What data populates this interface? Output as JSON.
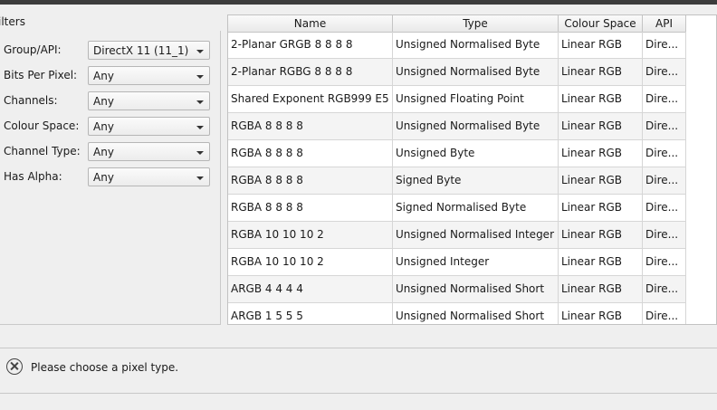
{
  "filters": {
    "title": "ilters",
    "rows": [
      {
        "label": "Group/API:",
        "value": "DirectX 11 (11_1)"
      },
      {
        "label": "Bits Per Pixel:",
        "value": "Any"
      },
      {
        "label": "Channels:",
        "value": "Any"
      },
      {
        "label": "Colour Space:",
        "value": "Any"
      },
      {
        "label": "Channel Type:",
        "value": "Any"
      },
      {
        "label": "Has Alpha:",
        "value": "Any"
      }
    ]
  },
  "table": {
    "columns": [
      "Name",
      "Type",
      "Colour Space",
      "API"
    ],
    "rows": [
      [
        "2-Planar GRGB 8 8 8 8",
        "Unsigned Normalised Byte",
        "Linear RGB",
        "Dire..."
      ],
      [
        "2-Planar RGBG 8 8 8 8",
        "Unsigned Normalised Byte",
        "Linear RGB",
        "Dire..."
      ],
      [
        "Shared Exponent RGB999 E5",
        "Unsigned Floating Point",
        "Linear RGB",
        "Dire..."
      ],
      [
        "RGBA 8 8 8 8",
        "Unsigned Normalised Byte",
        "Linear RGB",
        "Dire..."
      ],
      [
        "RGBA 8 8 8 8",
        "Unsigned Byte",
        "Linear RGB",
        "Dire..."
      ],
      [
        "RGBA 8 8 8 8",
        "Signed Byte",
        "Linear RGB",
        "Dire..."
      ],
      [
        "RGBA 8 8 8 8",
        "Signed Normalised Byte",
        "Linear RGB",
        "Dire..."
      ],
      [
        "RGBA 10 10 10 2",
        "Unsigned Normalised Integer",
        "Linear RGB",
        "Dire..."
      ],
      [
        "RGBA 10 10 10 2",
        "Unsigned Integer",
        "Linear RGB",
        "Dire..."
      ],
      [
        "ARGB 4 4 4 4",
        "Unsigned Normalised Short",
        "Linear RGB",
        "Dire..."
      ],
      [
        "ARGB 1 5 5 5",
        "Unsigned Normalised Short",
        "Linear RGB",
        "Dire..."
      ]
    ]
  },
  "status": {
    "icon": "error-circle-x-icon",
    "message": "Please choose a pixel type."
  }
}
